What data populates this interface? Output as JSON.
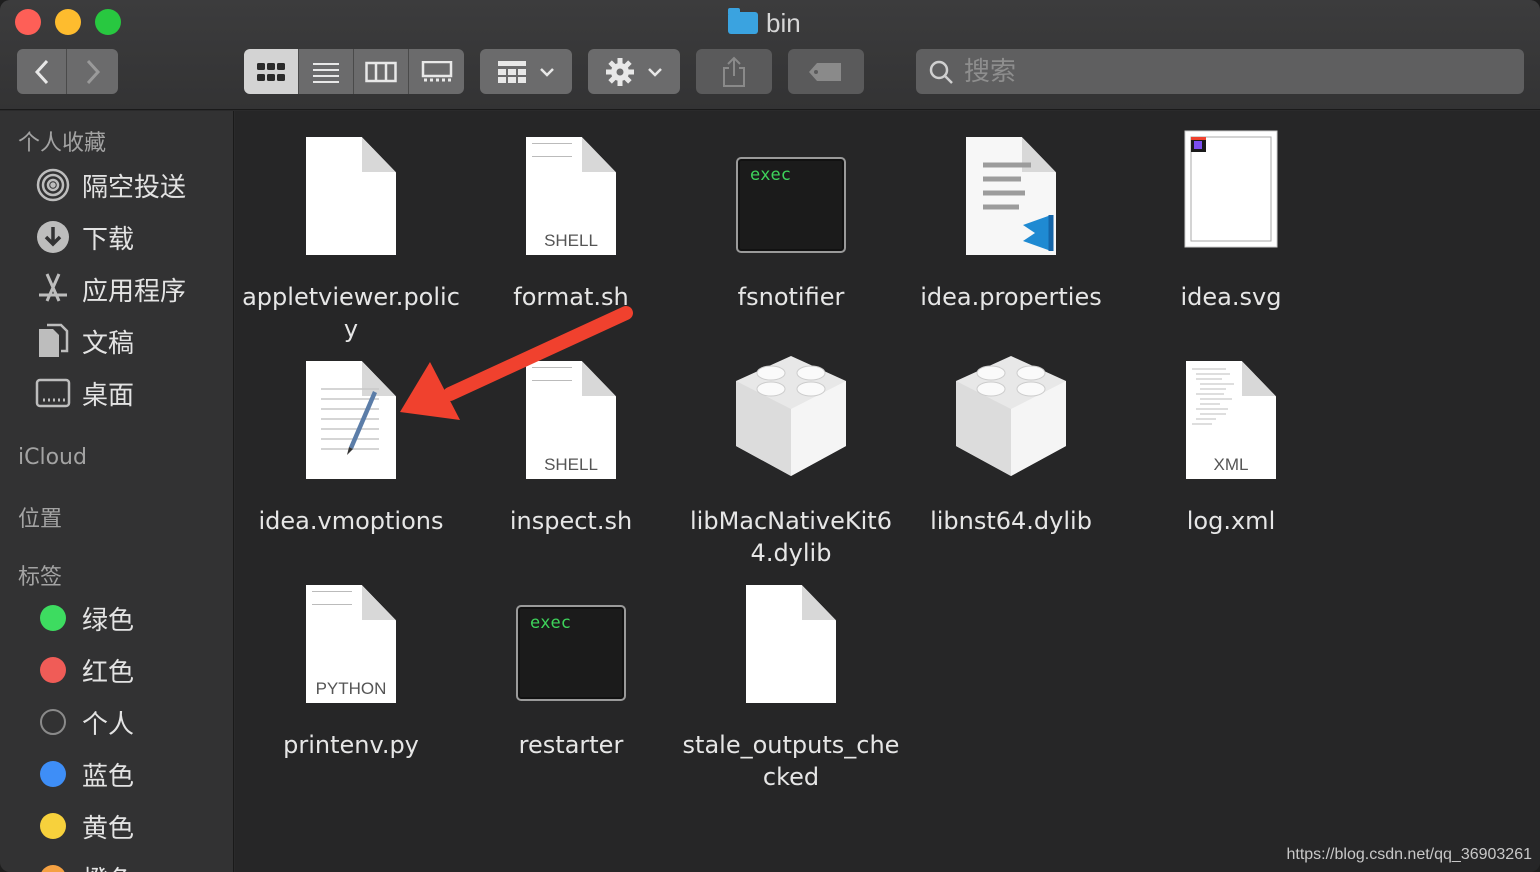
{
  "window": {
    "title": "bin",
    "colors": {
      "close": "#fe5f57",
      "minimize": "#febc2e",
      "maximize": "#28c840"
    }
  },
  "toolbar": {
    "search_placeholder": "搜索",
    "view_modes": [
      "icon-view",
      "list-view",
      "column-view",
      "gallery-view"
    ],
    "active_view": "icon-view"
  },
  "sidebar": {
    "favorites_header": "个人收藏",
    "favorites": [
      {
        "label": "隔空投送",
        "icon": "airdrop-icon"
      },
      {
        "label": "下载",
        "icon": "download-icon"
      },
      {
        "label": "应用程序",
        "icon": "applications-icon"
      },
      {
        "label": "文稿",
        "icon": "documents-icon"
      },
      {
        "label": "桌面",
        "icon": "desktop-icon"
      }
    ],
    "icloud_header": "iCloud",
    "locations_header": "位置",
    "tags_header": "标签",
    "tags": [
      {
        "label": "绿色",
        "color": "#3ddc60"
      },
      {
        "label": "红色",
        "color": "#f05c57"
      },
      {
        "label": "个人",
        "color": "transparent"
      },
      {
        "label": "蓝色",
        "color": "#3e8ef7"
      },
      {
        "label": "黄色",
        "color": "#f7d13c"
      },
      {
        "label": "橙色",
        "color": "#f5a142"
      }
    ]
  },
  "files": [
    {
      "name": "appletviewer.policy",
      "display": "appletviewer.polic\ny",
      "kind": "blank"
    },
    {
      "name": "format.sh",
      "display": "format.sh",
      "kind": "shell",
      "badge": "SHELL"
    },
    {
      "name": "fsnotifier",
      "display": "fsnotifier",
      "kind": "exec",
      "badge": "exec"
    },
    {
      "name": "idea.properties",
      "display": "idea.properties",
      "kind": "vscode"
    },
    {
      "name": "idea.svg",
      "display": "idea.svg",
      "kind": "svg"
    },
    {
      "name": "idea.vmoptions",
      "display": "idea.vmoptions",
      "kind": "textedit"
    },
    {
      "name": "inspect.sh",
      "display": "inspect.sh",
      "kind": "shell",
      "badge": "SHELL"
    },
    {
      "name": "libMacNativeKit64.dylib",
      "display": "libMacNativeKit6\n4.dylib",
      "kind": "dylib"
    },
    {
      "name": "libnst64.dylib",
      "display": "libnst64.dylib",
      "kind": "dylib"
    },
    {
      "name": "log.xml",
      "display": "log.xml",
      "kind": "xml",
      "badge": "XML"
    },
    {
      "name": "printenv.py",
      "display": "printenv.py",
      "kind": "python",
      "badge": "PYTHON"
    },
    {
      "name": "restarter",
      "display": "restarter",
      "kind": "exec",
      "badge": "exec"
    },
    {
      "name": "stale_outputs_checked",
      "display": "stale_outputs_che\ncked",
      "kind": "blank"
    }
  ],
  "annotation": {
    "arrow_color": "#f0412e",
    "target": "idea.vmoptions"
  },
  "watermark": "https://blog.csdn.net/qq_36903261"
}
